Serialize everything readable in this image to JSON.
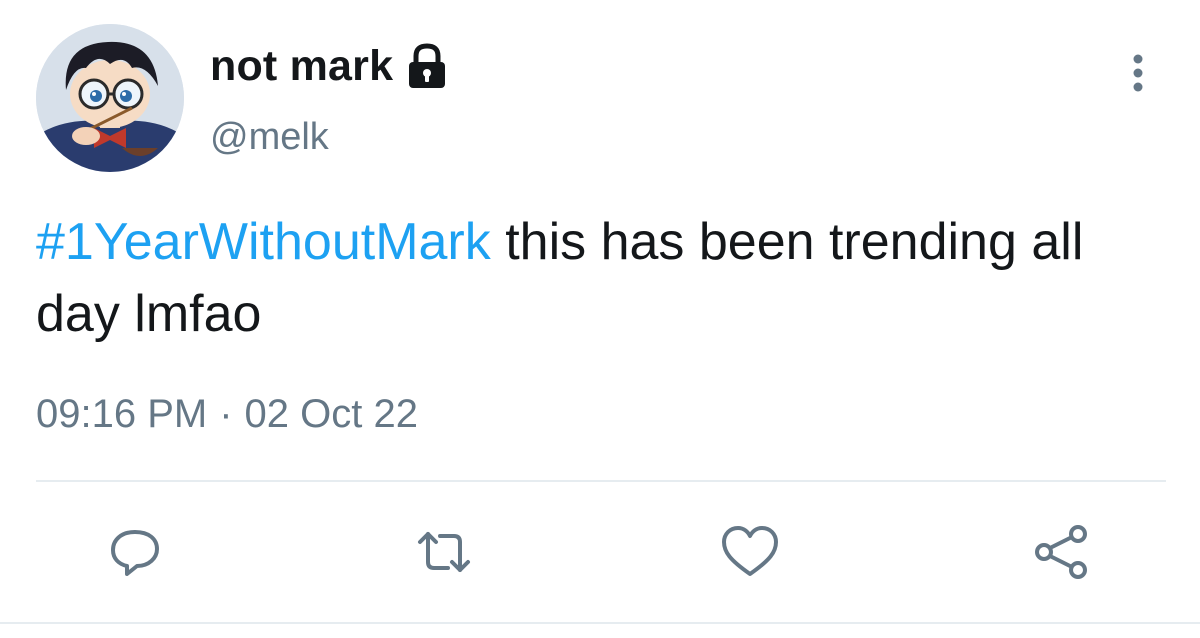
{
  "tweet": {
    "display_name": "not mark",
    "handle": "@melk",
    "hashtag": "#1YearWithoutMark",
    "text": " this has been trending all day lmfao",
    "time": "09:16 PM",
    "separator": "·",
    "date": "02 Oct 22"
  },
  "colors": {
    "hashtag": "#1da1f2",
    "secondary_text": "#657786",
    "primary_text": "#14171a",
    "divider": "#e6ecf0"
  },
  "icons": {
    "protected": "lock-icon",
    "more": "more-vertical-icon",
    "reply": "reply-icon",
    "retweet": "retweet-icon",
    "like": "heart-icon",
    "share": "share-icon"
  }
}
